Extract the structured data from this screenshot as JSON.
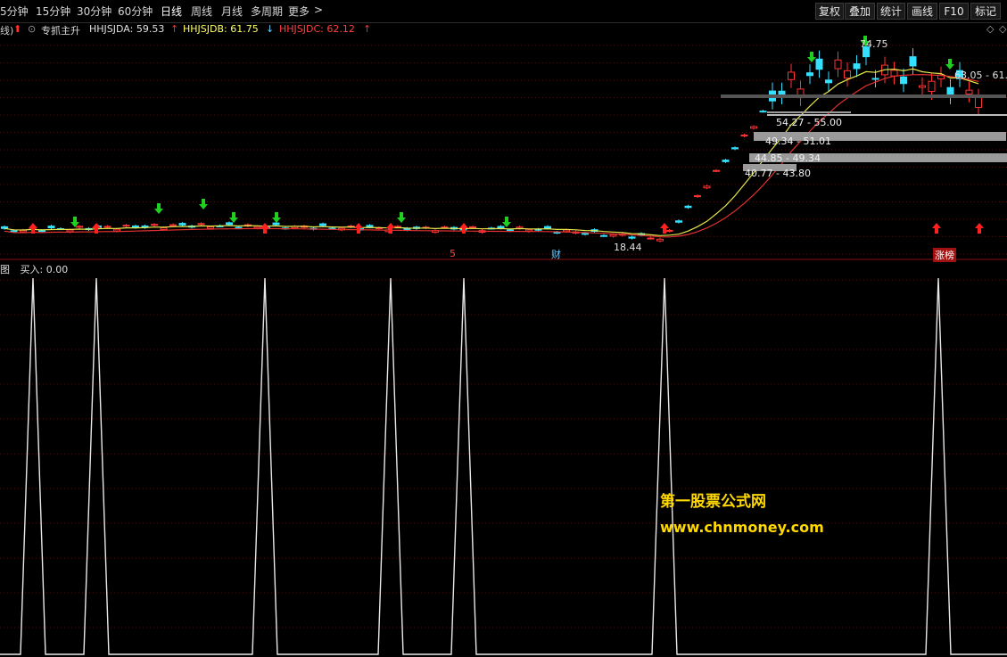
{
  "toolbar": {
    "periods": [
      "5分钟",
      "15分钟",
      "30分钟",
      "60分钟",
      "日线",
      "周线",
      "月线",
      "多周期",
      "更多"
    ],
    "active_period": "日线",
    "more_arrow": ">",
    "buttons": [
      "复权",
      "叠加",
      "统计",
      "画线",
      "F10",
      "标记"
    ]
  },
  "legend": {
    "lead_fragment": "线)",
    "indicator_name": "专抓主升",
    "a_label": "HHJSJDA: 59.53",
    "b_label": "HHJSJDB: 61.75",
    "c_label": "HHJSJDC: 62.12",
    "colors": {
      "a": "#e0e0e0",
      "b": "#ffff66",
      "c": "#ff4040"
    }
  },
  "main_chart": {
    "price_annotations": {
      "high": "74.75",
      "low": "18.44",
      "right_range": "63.05 - 61.",
      "bands": [
        "54.27 - 55.00",
        "49.34 - 51.01",
        "44.85 - 49.34",
        "40.77 - 43.80"
      ]
    },
    "markers": {
      "five": "5",
      "cai": "财",
      "zhangting": "涨榜"
    }
  },
  "sub_chart": {
    "title_fragment": "图",
    "label": "买入: 0.00",
    "spike_x": [
      37,
      108,
      297,
      438,
      520,
      745,
      1052
    ]
  },
  "watermark": {
    "line1": "第一股票公式网",
    "line2": "www.chnmoney.com"
  }
}
